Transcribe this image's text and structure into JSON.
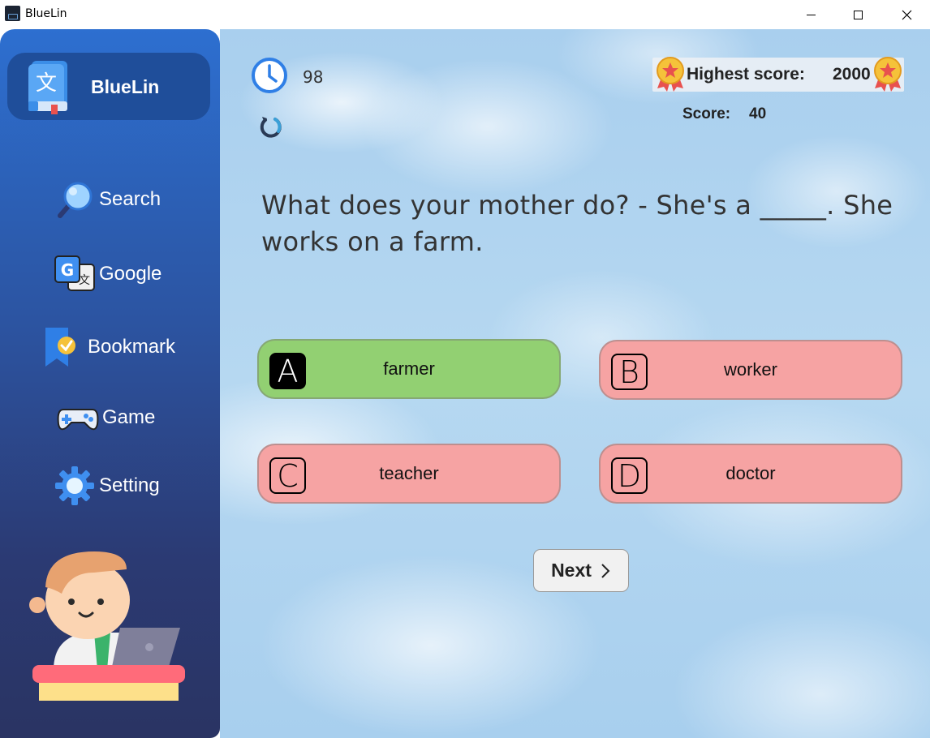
{
  "window": {
    "title": "BlueLin"
  },
  "sidebar": {
    "logo_text": "BlueLin",
    "logo_glyph": "文",
    "items": [
      {
        "label": "Search",
        "icon": "magnifier-icon"
      },
      {
        "label": "Google",
        "icon": "google-translate-icon"
      },
      {
        "label": "Bookmark",
        "icon": "bookmark-icon"
      },
      {
        "label": "Game",
        "icon": "gamepad-icon"
      },
      {
        "label": "Setting",
        "icon": "gear-icon"
      }
    ]
  },
  "game": {
    "timer": "98",
    "highest_score_label": "Highest score:",
    "highest_score_value": "2000",
    "score_label": "Score:",
    "score_value": "40",
    "question": "What does your mother do? - She's a _____. She works on a farm.",
    "options": [
      {
        "letter": "A",
        "text": "farmer",
        "state": "correct"
      },
      {
        "letter": "B",
        "text": "worker",
        "state": "wrong"
      },
      {
        "letter": "C",
        "text": "teacher",
        "state": "wrong"
      },
      {
        "letter": "D",
        "text": "doctor",
        "state": "wrong"
      }
    ],
    "next_label": "Next"
  },
  "colors": {
    "sidebar_top": "#2d6fd0",
    "sidebar_bottom": "#2a3463",
    "correct": "#92d072",
    "wrong": "#f6a3a3"
  }
}
